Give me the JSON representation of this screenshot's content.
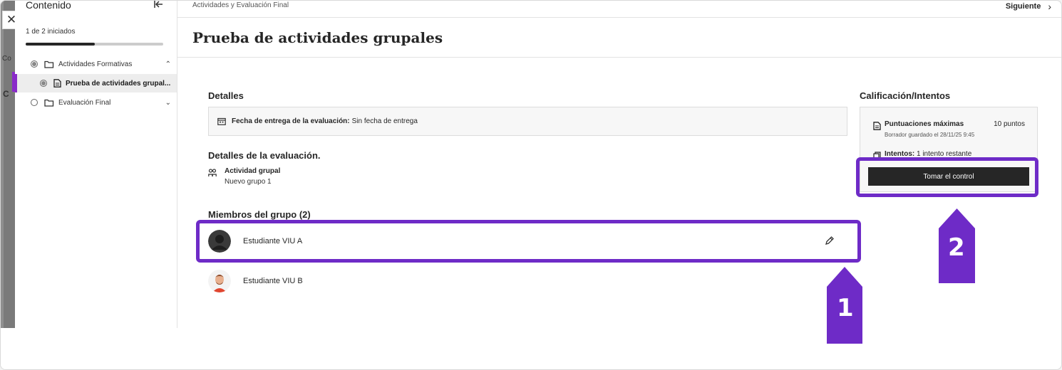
{
  "sidebar": {
    "title": "Contenido",
    "progress_text": "1 de 2 iniciados",
    "progress_fraction": 0.5,
    "items": [
      {
        "label": "Actividades Formativas",
        "chevron": "^"
      },
      {
        "label": "Prueba de actividades grupal..."
      },
      {
        "label": "Evaluación Final",
        "chevron": "v"
      }
    ]
  },
  "left_strip": {
    "tab_label": "Co",
    "letter": "C"
  },
  "header": {
    "breadcrumb": "Actividades y Evaluación Final",
    "next_label": "Siguiente",
    "title": "Prueba de actividades grupales"
  },
  "details": {
    "heading": "Detalles",
    "due_label": "Fecha de entrega de la evaluación:",
    "due_value": "Sin fecha de entrega",
    "eval_heading": "Detalles de la evaluación.",
    "group_type": "Actividad grupal",
    "group_name": "Nuevo grupo 1"
  },
  "members": {
    "heading": "Miembros del grupo (2)",
    "list": [
      {
        "name": "Estudiante VIU A"
      },
      {
        "name": "Estudiante VIU B"
      }
    ]
  },
  "grading": {
    "heading": "Calificación/Intentos",
    "max_label": "Puntuaciones máximas",
    "max_value": "10 puntos",
    "draft": "Borrador guardado el 28/11/25 9:45",
    "attempts_label": "Intentos:",
    "attempts_value": "1 intento restante",
    "take_button": "Tomar el control"
  },
  "annotations": {
    "badge1": "1",
    "badge2": "2",
    "highlight_color": "#6e2bc7"
  },
  "icons": [
    "close-icon",
    "collapse-left-icon",
    "folder-icon",
    "document-icon",
    "calendar-icon",
    "group-icon",
    "pencil-icon",
    "chevron-right-icon"
  ]
}
